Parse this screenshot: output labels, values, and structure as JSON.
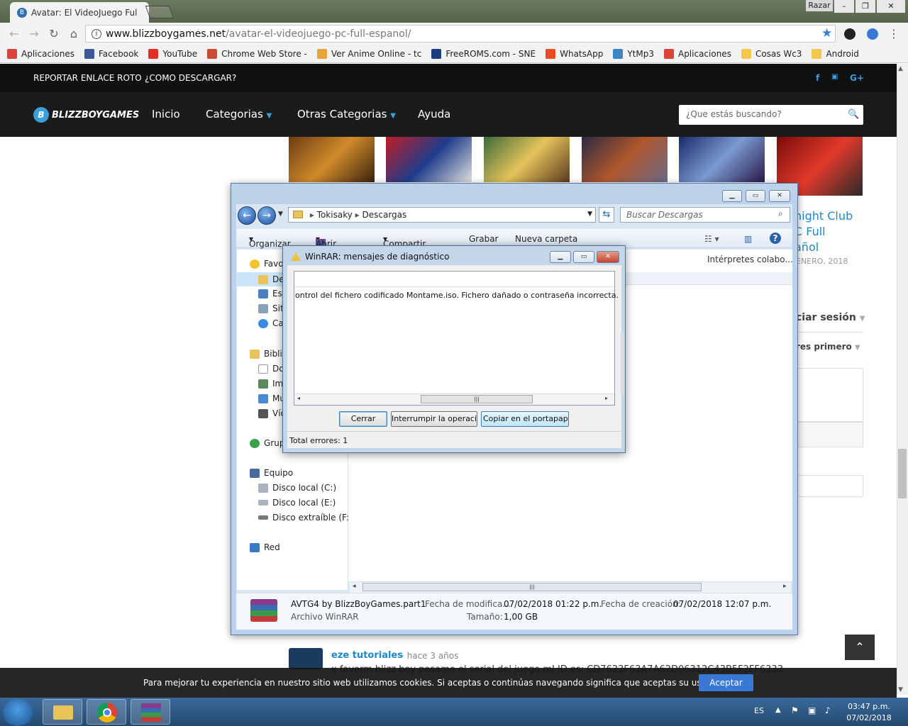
{
  "browser": {
    "tab_title": "Avatar: El VideoJuego Ful",
    "user_label": "Razar",
    "url_host": "www.blizzboygames.net",
    "url_path": "/avatar-el-videojuego-pc-full-espanol/",
    "bookmarks": [
      {
        "label": "Aplicaciones",
        "color": "#d9453b"
      },
      {
        "label": "Facebook",
        "color": "#3b5998"
      },
      {
        "label": "YouTube",
        "color": "#e52d27"
      },
      {
        "label": "Chrome Web Store -",
        "color": "#cc4b37"
      },
      {
        "label": "Ver Anime Online - tc",
        "color": "#e5a53b"
      },
      {
        "label": "FreeROMS.com - SNE",
        "color": "#1d3f7a"
      },
      {
        "label": "WhatsApp",
        "color": "#e84b25"
      },
      {
        "label": "YtMp3",
        "color": "#3a86c8"
      },
      {
        "label": "Aplicaciones",
        "color": "#d9453b"
      },
      {
        "label": "Cosas Wc3",
        "color": "#f2c94c"
      },
      {
        "label": "Android",
        "color": "#f2c94c"
      }
    ]
  },
  "site": {
    "top_links": [
      "REPORTAR ENLACE ROTO",
      "¿COMO DESCARGAR?"
    ],
    "logo": "BLIZZBOYGAMES",
    "nav": [
      "Inicio",
      "Categorias",
      "Otras Categorias",
      "Ayuda"
    ],
    "search_placeholder": "¿Que estás buscando?",
    "sidebar_title": "night Club\nC Full\nañol",
    "sidebar_date": "ENERO, 2018",
    "session": "ciar sesión",
    "sort": "res primero",
    "comment_author": "eze tutoriales",
    "comment_time": "· hace 3 años",
    "comment_text": "x favorm blizz boy pasame el serial del juego mI ID es: CD7623F63A7A62D06312C43B5F2FF6333",
    "cookie_text": "Para mejorar tu experiencia en nuestro sitio web utilizamos cookies. Si aceptas o continúas navegando significa que aceptas su uso.",
    "accept": "Aceptar"
  },
  "explorer": {
    "path": [
      "Tokisaky",
      "Descargas"
    ],
    "search_placeholder": "Buscar Descargas",
    "toolbar": [
      "Organizar",
      "Abrir",
      "Compartir con",
      "Grabar",
      "Nueva carpeta"
    ],
    "nav_items": [
      {
        "label": "Favo",
        "top": 0
      },
      {
        "label": "De"
      },
      {
        "label": "Esc"
      },
      {
        "label": "Sit"
      },
      {
        "label": "Ca"
      },
      {
        "label": "Bibli"
      },
      {
        "label": "Do"
      },
      {
        "label": "Im"
      },
      {
        "label": "Mu"
      },
      {
        "label": "Víd"
      },
      {
        "label": "Grup"
      },
      {
        "label": "Equipo"
      },
      {
        "label": "Disco local (C:)"
      },
      {
        "label": "Disco local (E:)"
      },
      {
        "label": "Disco extraíble (F:)"
      },
      {
        "label": "Red"
      }
    ],
    "column_header": "Intérpretes colabo...",
    "file_name": "AVTG4 by BlizzBoyGames.part1",
    "file_type": "Archivo WinRAR",
    "modified_label": "Fecha de modifica...",
    "modified_value": "07/02/2018 01:22 p.m.",
    "created_label": "Fecha de creación:",
    "created_value": "07/02/2018 12:07 p.m.",
    "size_label": "Tamaño:",
    "size_value": "1,00 GB"
  },
  "dialog": {
    "title": "WinRAR: mensajes de diagnóstico",
    "message": "ontrol del fichero codificado Montame.iso. Fichero dañado o contraseña incorrecta.",
    "btn_close": "Cerrar",
    "btn_interrupt": "Interrumpir la operación",
    "btn_copy": "Copiar en el portapapeles",
    "total": "Total errores: 1"
  },
  "taskbar": {
    "lang": "ES",
    "time": "03:47 p.m.",
    "date": "07/02/2018"
  }
}
